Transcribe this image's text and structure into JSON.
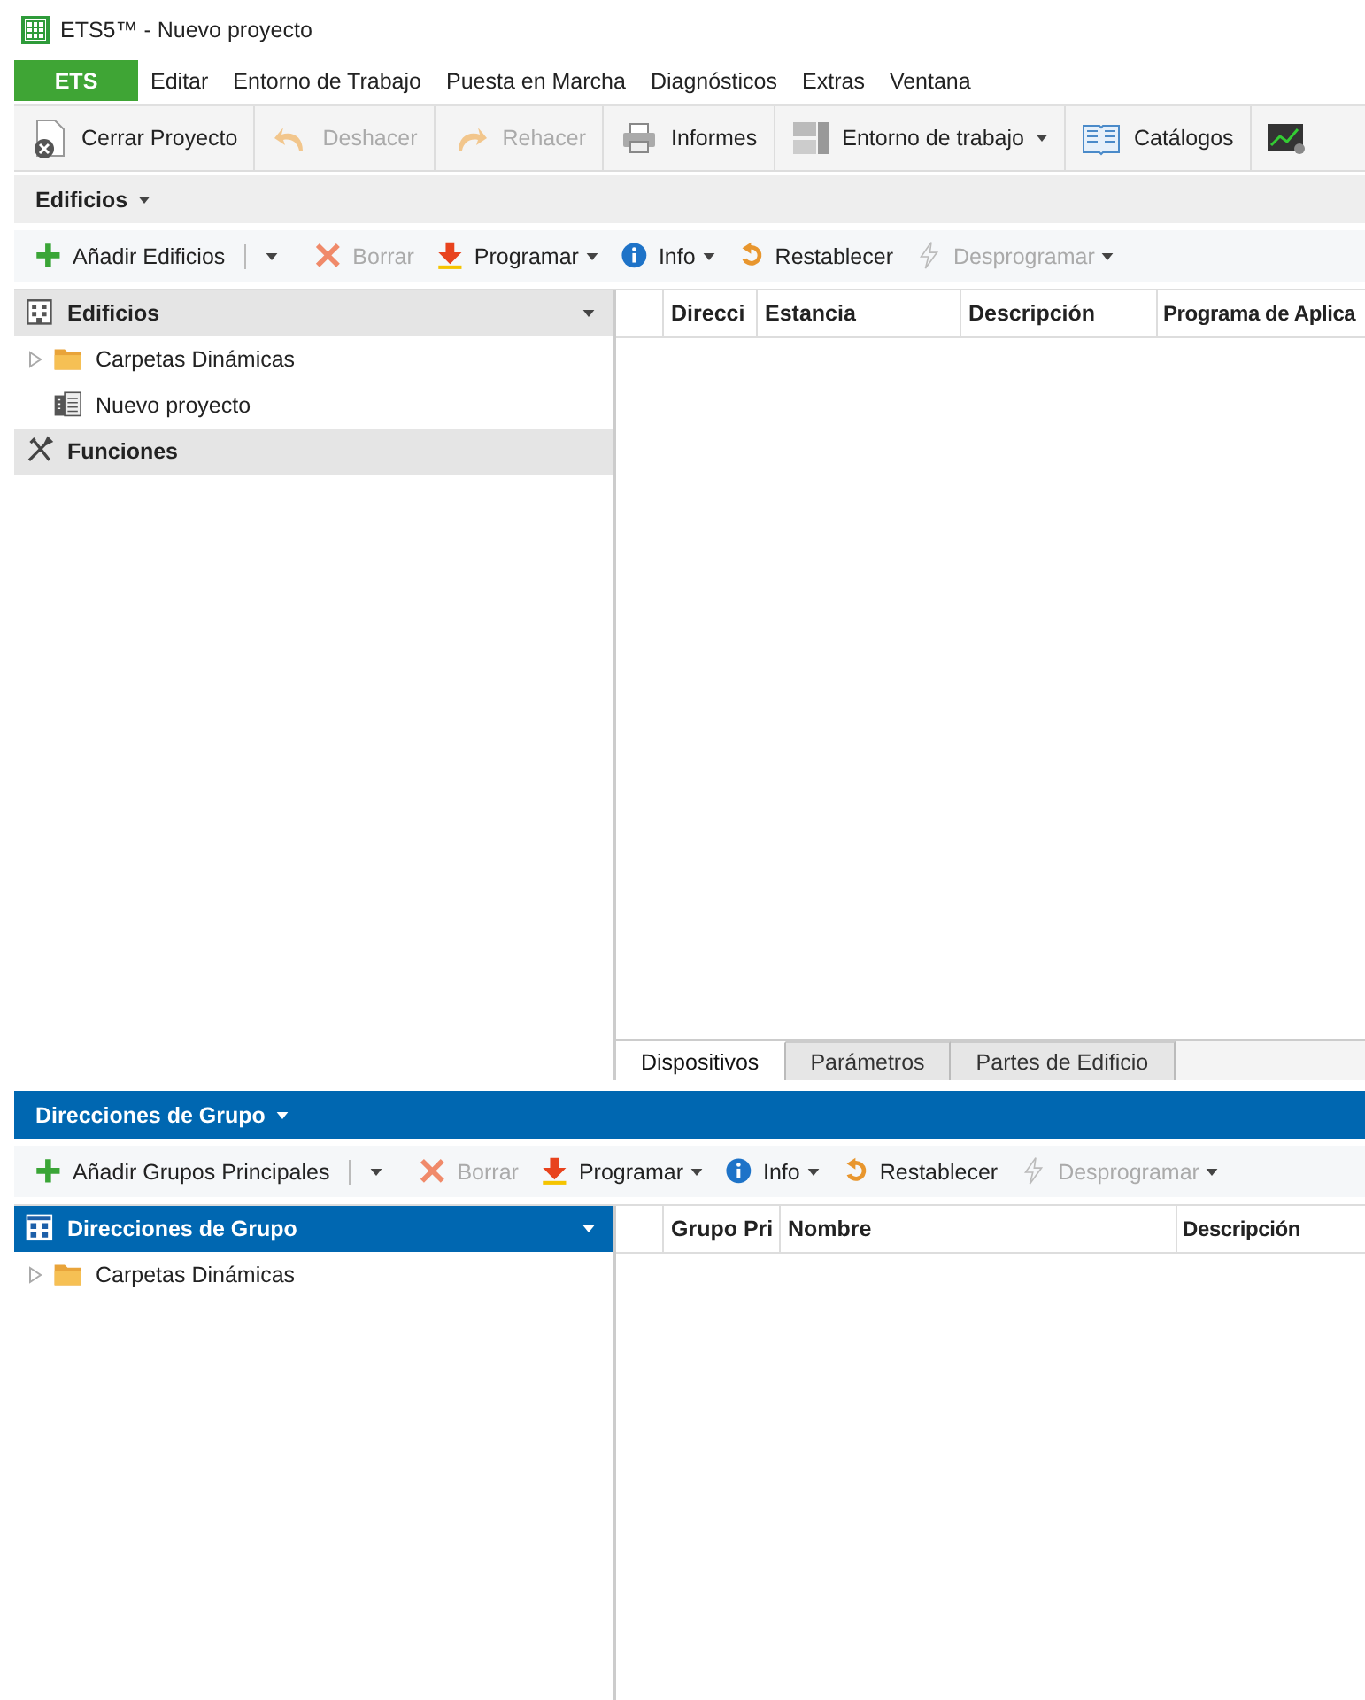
{
  "window": {
    "title": "ETS5™ - Nuevo proyecto"
  },
  "menu": [
    {
      "label": "ETS",
      "selected": true
    },
    {
      "label": "Editar",
      "selected": false
    },
    {
      "label": "Entorno de Trabajo",
      "selected": false
    },
    {
      "label": "Puesta en Marcha",
      "selected": false
    },
    {
      "label": "Diagnósticos",
      "selected": false
    },
    {
      "label": "Extras",
      "selected": false
    },
    {
      "label": "Ventana",
      "selected": false
    }
  ],
  "toolbar": [
    {
      "label": "Cerrar Proyecto",
      "disabled": false,
      "dropdown": false
    },
    {
      "label": "Deshacer",
      "disabled": true,
      "dropdown": false
    },
    {
      "label": "Rehacer",
      "disabled": true,
      "dropdown": false
    },
    {
      "label": "Informes",
      "disabled": false,
      "dropdown": false
    },
    {
      "label": "Entorno de trabajo",
      "disabled": false,
      "dropdown": true
    },
    {
      "label": "Catálogos",
      "disabled": false,
      "dropdown": false
    }
  ],
  "panels": [
    {
      "title": "Edificios",
      "active": false,
      "actions": [
        {
          "label": "Añadir Edificios",
          "kind": "split",
          "disabled": false,
          "dropdown": true
        },
        {
          "label": "Borrar",
          "kind": "plain",
          "disabled": true,
          "dropdown": false
        },
        {
          "label": "Programar",
          "kind": "plain",
          "disabled": false,
          "dropdown": true
        },
        {
          "label": "Info",
          "kind": "plain",
          "disabled": false,
          "dropdown": true
        },
        {
          "label": "Restablecer",
          "kind": "plain",
          "disabled": false,
          "dropdown": false
        },
        {
          "label": "Desprogramar",
          "kind": "plain",
          "disabled": true,
          "dropdown": true
        }
      ],
      "tree_sections": [
        {
          "kind": "building",
          "title": "Edificios",
          "selected": false,
          "dropdown": true,
          "items": [
            {
              "kind": "folder",
              "label": "Carpetas Dinámicas",
              "expandable": true
            },
            {
              "kind": "project",
              "label": "Nuevo proyecto",
              "expandable": false
            }
          ]
        },
        {
          "kind": "tools",
          "title": "Funciones",
          "selected": false,
          "dropdown": false
        }
      ],
      "table": {
        "columns": [
          "Direcci",
          "Estancia",
          "Descripción",
          "Programa de Aplica"
        ]
      },
      "tabs": [
        {
          "label": "Dispositivos",
          "selected": true
        },
        {
          "label": "Parámetros",
          "selected": false
        },
        {
          "label": "Partes de Edificio",
          "selected": false
        }
      ]
    },
    {
      "title": "Direcciones de Grupo",
      "active": true,
      "actions": [
        {
          "label": "Añadir Grupos Principales",
          "kind": "split",
          "disabled": false,
          "dropdown": true
        },
        {
          "label": "Borrar",
          "kind": "plain",
          "disabled": true,
          "dropdown": false
        },
        {
          "label": "Programar",
          "kind": "plain",
          "disabled": false,
          "dropdown": true
        },
        {
          "label": "Info",
          "kind": "plain",
          "disabled": false,
          "dropdown": true
        },
        {
          "label": "Restablecer",
          "kind": "plain",
          "disabled": false,
          "dropdown": false
        },
        {
          "label": "Desprogramar",
          "kind": "plain",
          "disabled": true,
          "dropdown": true
        }
      ],
      "tree_sections": [
        {
          "kind": "grid",
          "title": "Direcciones de Grupo",
          "selected": true,
          "dropdown": true,
          "items": [
            {
              "kind": "folder",
              "label": "Carpetas Dinámicas",
              "expandable": true
            }
          ]
        }
      ],
      "table": {
        "columns": [
          "Grupo Pri",
          "Nombre",
          "Descripción"
        ]
      }
    }
  ]
}
